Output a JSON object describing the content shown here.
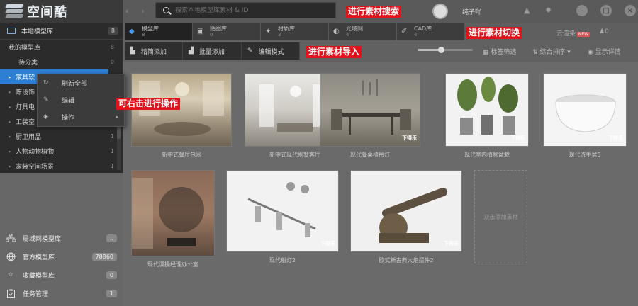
{
  "app": {
    "logo_text": "空间酷"
  },
  "search": {
    "placeholder": "搜索本地模型库素材 & ID"
  },
  "user": {
    "name": "纯子吖"
  },
  "sidebar": {
    "local_lib": {
      "label": "本地模型库",
      "count": "8"
    },
    "tree": [
      {
        "label": "我的模型库",
        "count": "8",
        "level": 0,
        "arrow": false,
        "selected": false
      },
      {
        "label": "待分类",
        "count": "0",
        "level": 1,
        "arrow": false,
        "selected": false
      },
      {
        "label": "家具软",
        "count": "",
        "level": 1,
        "arrow": true,
        "selected": true
      },
      {
        "label": "陈设饰",
        "count": "",
        "level": 1,
        "arrow": true,
        "selected": false
      },
      {
        "label": "灯具电",
        "count": "",
        "level": 1,
        "arrow": true,
        "selected": false
      },
      {
        "label": "工装空",
        "count": "",
        "level": 1,
        "arrow": true,
        "selected": false
      },
      {
        "label": "厨卫用品",
        "count": "1",
        "level": 1,
        "arrow": true,
        "selected": false
      },
      {
        "label": "人物动物植物",
        "count": "1",
        "level": 1,
        "arrow": true,
        "selected": false
      },
      {
        "label": "家装空间场景",
        "count": "1",
        "level": 1,
        "arrow": true,
        "selected": false
      }
    ],
    "libs": [
      {
        "label": "局域网模型库",
        "count": ".."
      },
      {
        "label": "官方模型库",
        "count": "78860"
      },
      {
        "label": "收藏模型库",
        "count": "0"
      },
      {
        "label": "任务管理",
        "count": "1"
      }
    ]
  },
  "context_menu": {
    "items": [
      {
        "label": "刷新全部",
        "has_sub": false
      },
      {
        "label": "编辑",
        "has_sub": true
      },
      {
        "label": "操作",
        "has_sub": true
      }
    ]
  },
  "tabs": [
    {
      "label": "模型库",
      "count": "8",
      "active": true
    },
    {
      "label": "贴图库",
      "count": "0",
      "active": false
    },
    {
      "label": "材质库",
      "count": "3",
      "active": false
    },
    {
      "label": "光域网",
      "count": "4",
      "active": false
    },
    {
      "label": "CAD库",
      "count": "4",
      "active": false
    }
  ],
  "cloud_render": {
    "label": "云渲染",
    "new_badge": "NEW"
  },
  "user_count": "0",
  "toolbar": {
    "add_simple": "精简添加",
    "add_batch": "批量添加",
    "edit_mode": "编辑模式",
    "tag_filter": "标签筛选",
    "sort": "综合排序",
    "show_details": "显示详情",
    "zoom": 0.42
  },
  "assets": [
    {
      "name": "新中式餐厅包间",
      "watermark": ""
    },
    {
      "name": "新中式现代别墅客厅",
      "watermark": ""
    },
    {
      "name": "现代餐桌椅吊灯",
      "watermark": "下得乐"
    },
    {
      "name": "现代室内植物盆栽",
      "watermark": "下得乐"
    },
    {
      "name": "现代洗手盆5",
      "watermark": "下得乐"
    },
    {
      "name": "现代漂操经理办公室",
      "watermark": ""
    },
    {
      "name": "现代射灯2",
      "watermark": "下得乐"
    },
    {
      "name": "欧式新古典大炮摆件2",
      "watermark": "下得乐"
    }
  ],
  "add_asset_label": "双击添加素材",
  "callouts": {
    "search": "进行素材搜索",
    "switch": "进行素材切换",
    "import": "进行素材导入",
    "right_click": "可右击进行操作"
  },
  "colors": {
    "callout": "#e3111a",
    "selected": "#2d7fd3",
    "panel_dark": "#2b2b2b"
  }
}
